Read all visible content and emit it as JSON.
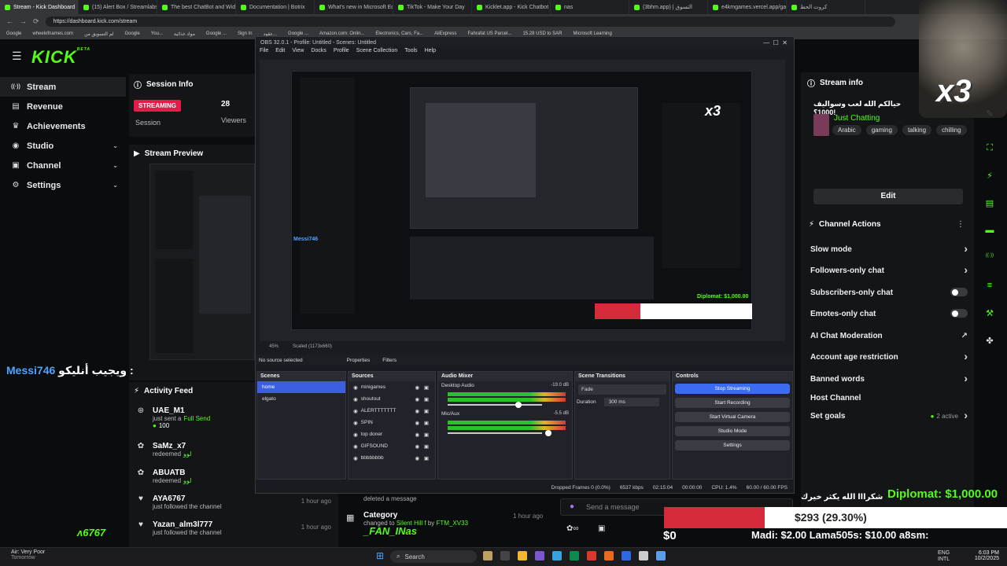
{
  "browser": {
    "tabs": [
      {
        "label": "Stream - Kick Dashboard",
        "active": true
      },
      {
        "label": "(15) Alert Box / Streamlabs"
      },
      {
        "label": "The best ChatBot and Widg..."
      },
      {
        "label": "Documentation | Botrix"
      },
      {
        "label": "What's new in Microsoft Ed..."
      },
      {
        "label": "TikTok - Make Your Day"
      },
      {
        "label": "Kicklet.app - Kick Chatbot"
      },
      {
        "label": "nas"
      },
      {
        "label": "(3bhm.app) | التسوق"
      },
      {
        "label": "e4kmgames.vercel.app/gan..."
      },
      {
        "label": "كروت الحظ"
      }
    ],
    "url": "https://dashboard.kick.com/stream",
    "bookmarks": [
      "Google",
      "wheelofnames.com",
      "لم التسويق من",
      "Google",
      "You...",
      "مواد غذائية",
      "Google ...",
      "Sign In",
      "عقود...",
      "Google ...",
      "Amazon.com: Onlin...",
      "Electronics, Cars, Fa...",
      "AliExpress",
      "Fahrafat US Parcel...",
      "15.28 USD to SAR",
      "Microsoft Learning"
    ]
  },
  "kick": {
    "logo": "KICK",
    "logo_badge": "BETA",
    "sidebar": [
      {
        "label": "Stream",
        "icon": "broadcast-icon",
        "active": true
      },
      {
        "label": "Revenue",
        "icon": "ledger-icon"
      },
      {
        "label": "Achievements",
        "icon": "trophy-icon"
      },
      {
        "label": "Studio",
        "icon": "palette-icon",
        "chevron": true
      },
      {
        "label": "Channel",
        "icon": "channel-icon",
        "chevron": true
      },
      {
        "label": "Settings",
        "icon": "gear-icon",
        "chevron": true
      }
    ],
    "session_info": {
      "title": "Session Info",
      "status": "STREAMING",
      "session_label": "Session",
      "viewers_value": "28",
      "viewers_label": "Viewers"
    },
    "stream_preview_title": "Stream Preview",
    "activity_feed": {
      "title": "Activity Feed",
      "items": [
        {
          "name": "UAE_M1",
          "line1": "just sent a",
          "highlight": "Full Send",
          "line2": "100",
          "icon": "kick-coin-icon",
          "time": ""
        },
        {
          "name": "SaMz_x7",
          "line1": "redeemed",
          "highlight": "لوو",
          "icon": "reward-icon",
          "time": ""
        },
        {
          "name": "ABUATB",
          "line1": "redeemed",
          "highlight": "لوو",
          "icon": "reward-icon",
          "time": ""
        },
        {
          "name": "AYA6767",
          "line1": "just followed the channel",
          "icon": "heart-icon",
          "time": "1 hour ago"
        },
        {
          "name": "Yazan_alm3l777",
          "line1": "just followed the channel",
          "icon": "heart-icon",
          "time": "1 hour ago"
        }
      ]
    },
    "stream_info": {
      "title": "Stream info",
      "stream_title": "حيالكم الله لعب وسواليف !1000؟",
      "category": "Just Chatting",
      "tags": [
        "Arabic",
        "gaming",
        "talking",
        "chilling"
      ],
      "edit_label": "Edit"
    },
    "channel_actions": {
      "title": "Channel Actions",
      "items": [
        {
          "label": "Slow mode",
          "control": "chevron"
        },
        {
          "label": "Followers-only chat",
          "control": "chevron"
        },
        {
          "label": "Subscribers-only chat",
          "control": "toggle"
        },
        {
          "label": "Emotes-only chat",
          "control": "toggle"
        },
        {
          "label": "AI Chat Moderation",
          "control": "external"
        },
        {
          "label": "Account age restriction",
          "control": "chevron"
        },
        {
          "label": "Banned words",
          "control": "chevron"
        },
        {
          "label": "Host Channel",
          "control": "none"
        },
        {
          "label": "Set goals",
          "control": "chevron",
          "extra": "2 active"
        }
      ]
    },
    "category_event": {
      "label": "Category",
      "text": "changed to",
      "value": "Silent Hill f",
      "by": "by",
      "user": "FTM_XV33",
      "time": "1 hour ago"
    },
    "deleted_msg": "deleted a message",
    "chat_placeholder": "Send a message"
  },
  "obs": {
    "title": "OBS 32.0.1 - Profile: Untitled - Scenes: Untitled",
    "menu": [
      "File",
      "Edit",
      "View",
      "Docks",
      "Profile",
      "Scene Collection",
      "Tools",
      "Help"
    ],
    "zoom": "45%",
    "scaled": "Scaled (1173x660)",
    "no_source": "No source selected",
    "properties": "Properties",
    "filters": "Filters",
    "scenes_title": "Scenes",
    "scenes": [
      "home",
      "elgato"
    ],
    "sources_title": "Sources",
    "sources": [
      "minigames",
      "shoutout",
      "ALERTTTTTTT",
      "SPIN",
      "top doner",
      "GIFSOUND",
      "bbbbbbbb"
    ],
    "mixer_title": "Audio Mixer",
    "mixer": [
      {
        "name": "Desktop Audio",
        "db": "-19.0 dB"
      },
      {
        "name": "Mic/Aux",
        "db": "-5.5 dB"
      }
    ],
    "transitions_title": "Scene Transitions",
    "transition": "Fade",
    "duration_label": "Duration",
    "duration": "300 ms",
    "controls_title": "Controls",
    "controls": [
      "Stop Streaming",
      "Start Recording",
      "Start Virtual Camera",
      "Studio Mode",
      "Settings"
    ],
    "status": {
      "dropped": "Dropped Frames 0 (0.0%)",
      "kbps": "6537 kbps",
      "live_time": "02:15:04",
      "rec_time": "00:00:00",
      "cpu": "CPU: 1.4%",
      "fps": "60.00 / 60.00 FPS"
    }
  },
  "overlay": {
    "chat_user": "Messi746",
    "chat_text": "ويجيب أنليكو :",
    "goal_title": "Diplomat: $1,000.00",
    "goal_progress_text": "$293 (29.30%)",
    "goal_progress": 0.293,
    "goal_start": "$0",
    "ticker": "Madi: $2.00   Lama505s: $10.00   a8sm:",
    "thanks": "شكرااا الله يكثر خيرك",
    "multiplier": "x3",
    "fan_mark": "_FAN_INas",
    "code_mark": "ʌ6767"
  },
  "taskbar": {
    "weather_line1": "Air: Very Poor",
    "weather_line2": "Tomorrow",
    "search": "Search",
    "lang1": "ENG",
    "lang2": "INTL",
    "time": "6:03 PM",
    "date": "10/2/2025"
  },
  "colors": {
    "kick_green": "#53fc18",
    "streaming_red": "#e11d48",
    "obs_blue": "#3b6cf0",
    "goal_red": "#d42a3c"
  }
}
